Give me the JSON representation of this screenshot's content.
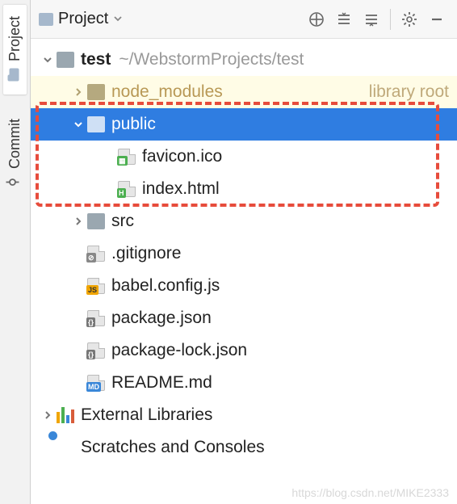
{
  "side_tabs": {
    "project": "Project",
    "commit": "Commit"
  },
  "toolbar": {
    "title": "Project"
  },
  "tree": {
    "root": {
      "name": "test",
      "path": "~/WebstormProjects/test"
    },
    "node_modules": {
      "name": "node_modules",
      "note": "library root"
    },
    "public": {
      "name": "public"
    },
    "favicon": {
      "name": "favicon.ico"
    },
    "indexhtml": {
      "name": "index.html"
    },
    "src": {
      "name": "src"
    },
    "gitignore": {
      "name": ".gitignore"
    },
    "babel": {
      "name": "babel.config.js"
    },
    "pkg": {
      "name": "package.json"
    },
    "pkglock": {
      "name": "package-lock.json"
    },
    "readme": {
      "name": "README.md"
    },
    "extlib": {
      "name": "External Libraries"
    },
    "scratch": {
      "name": "Scratches and Consoles"
    }
  },
  "watermark": "https://blog.csdn.net/MIKE2333"
}
